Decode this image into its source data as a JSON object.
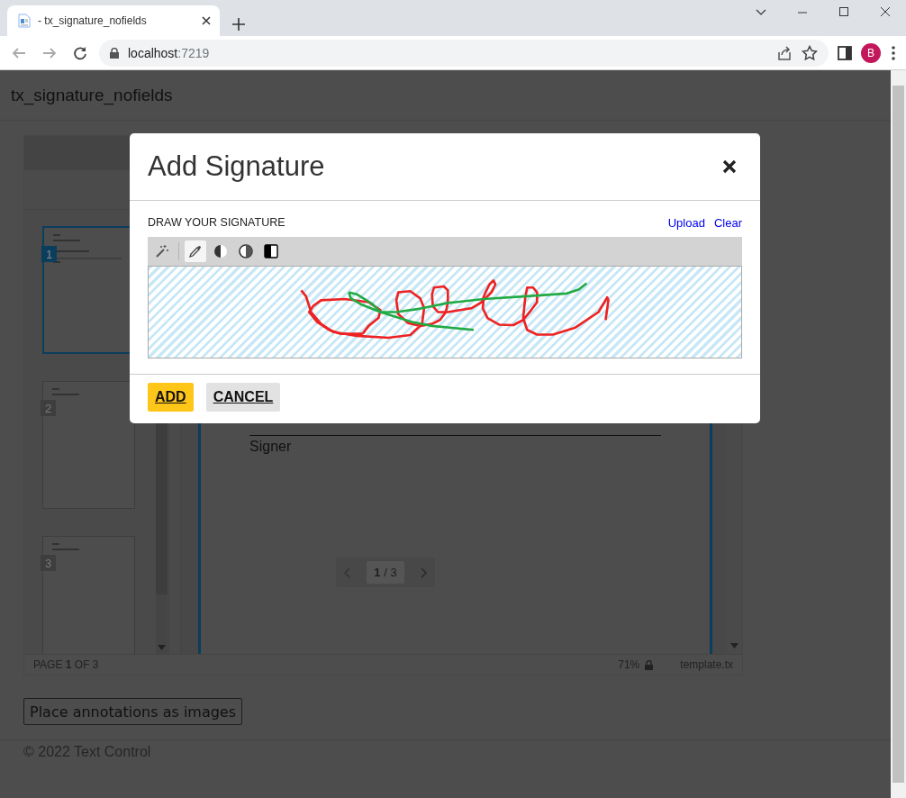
{
  "browser": {
    "tab_title": "- tx_signature_nofields",
    "address_host": "localhost",
    "address_port": ":7219",
    "profile_initial": "B"
  },
  "page": {
    "title": "tx_signature_nofields",
    "thumbnails": [
      {
        "number": "1",
        "selected": true
      },
      {
        "number": "2",
        "selected": false
      },
      {
        "number": "3",
        "selected": false
      }
    ],
    "document": {
      "signature_label": "Signer",
      "pager": "**1** / 3"
    },
    "status_bar": {
      "page": "PAGE **1** OF 3",
      "zoom": "71%",
      "file": "template.tx"
    },
    "button": "Place annotations as images",
    "footer": "© 2022 Text Control"
  },
  "dialog": {
    "title": "Add Signature",
    "section_label": "DRAW YOUR SIGNATURE",
    "links": [
      "Upload",
      "Clear"
    ],
    "tools": [
      {
        "kind": "wand",
        "selected": false
      },
      {
        "kind": "pipette",
        "selected": true
      },
      {
        "kind": "contrast",
        "selected": false
      },
      {
        "kind": "contrast-ring",
        "selected": false
      },
      {
        "kind": "invert",
        "selected": false
      }
    ],
    "buttons": [
      {
        "label": "ADD",
        "kind": "primary"
      },
      {
        "label": "CANCEL",
        "kind": "secondary"
      }
    ]
  }
}
